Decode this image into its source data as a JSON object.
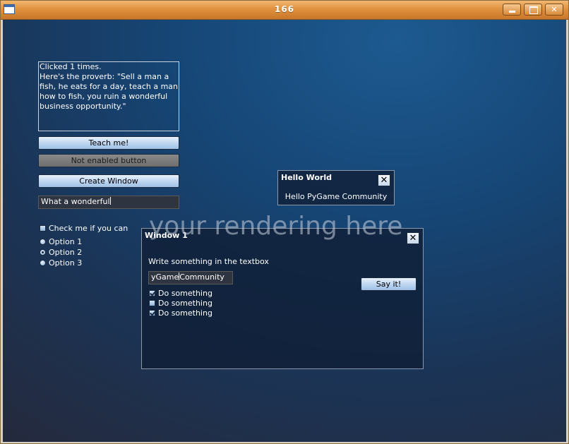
{
  "window": {
    "title": "166",
    "minimize_symbol": "",
    "maximize_symbol": "",
    "close_symbol": "✕"
  },
  "main": {
    "output_text": "Clicked 1 times.\nHere's the proverb: \"Sell a man a fish, he eats for a day, teach a man how to fish, you ruin a wonderful business opportunity.\"",
    "teach_button": "Teach me!",
    "disabled_button": "Not enabled button",
    "create_window_button": "Create Window",
    "textfield_value": "What a wonderful",
    "checkbox_label": "Check me if you can",
    "checkbox_checked": false,
    "radios": [
      {
        "label": "Option 1",
        "checked": false
      },
      {
        "label": "Option 2",
        "checked": true
      },
      {
        "label": "Option 3",
        "checked": false
      }
    ]
  },
  "hello_dialog": {
    "title": "Hello World",
    "message": "Hello PyGame Community",
    "close_symbol": "✕"
  },
  "watermark": "your rendering here",
  "window1": {
    "title": "Window 1",
    "close_symbol": "✕",
    "prompt": "Write something in the textbox",
    "textbox_left": "yGame",
    "textbox_right": "Community",
    "say_button": "Say it!",
    "checkboxes": [
      {
        "label": "Do something",
        "checked": true
      },
      {
        "label": "Do something",
        "checked": false
      },
      {
        "label": "Do something",
        "checked": true
      }
    ]
  },
  "colors": {
    "accent": "#e0913d",
    "background": "#164676",
    "button": "#b8d2ef"
  }
}
